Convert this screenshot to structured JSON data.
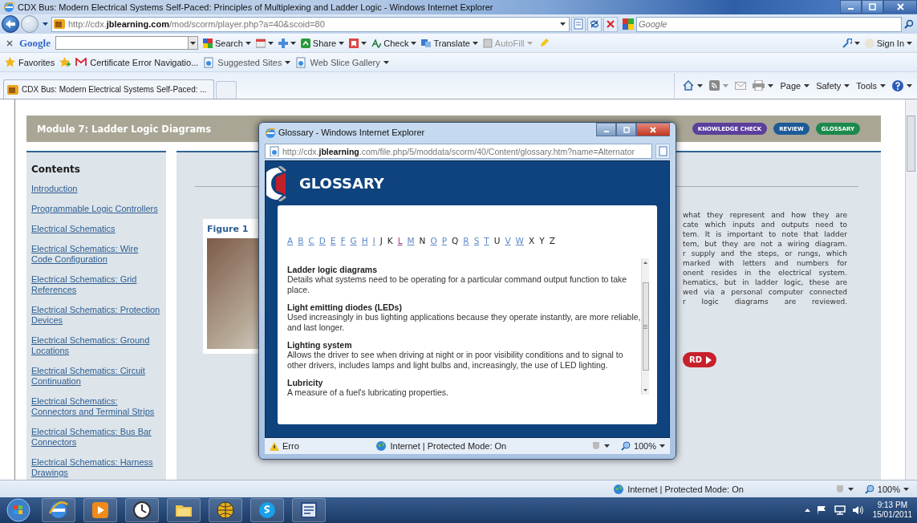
{
  "window": {
    "title": "CDX Bus: Modern Electrical Systems Self-Paced: Principles of Multiplexing and Ladder Logic - Windows Internet Explorer",
    "url": "http://cdx.**jblearning.com**/mod/scorm/player.php?a=40&scoid=80",
    "search_placeholder": "Google"
  },
  "google_toolbar": {
    "logo": "Google",
    "items": [
      {
        "label": "Search",
        "kind": "search",
        "disabled": false
      },
      {
        "label": "Share",
        "kind": "share",
        "disabled": false
      },
      {
        "label": "Check",
        "kind": "check",
        "disabled": false
      },
      {
        "label": "Translate",
        "kind": "translate",
        "disabled": false
      },
      {
        "label": "AutoFill",
        "kind": "autofill",
        "disabled": true
      }
    ],
    "sign_in": "Sign In"
  },
  "favorites_bar": {
    "label": "Favorites",
    "items": [
      {
        "label": "Certificate Error Navigatio...",
        "kind": "mail",
        "menu": false
      },
      {
        "label": "Suggested Sites",
        "kind": "page",
        "menu": true
      },
      {
        "label": "Web Slice Gallery",
        "kind": "page",
        "menu": true
      }
    ]
  },
  "tabs": [
    {
      "label": "CDX Bus: Modern Electrical Systems Self-Paced: ...",
      "selected": true
    }
  ],
  "command_bar": [
    "Page",
    "Safety",
    "Tools"
  ],
  "page": {
    "module_title": "Module 7: Ladder Logic Diagrams",
    "nav_buttons": [
      {
        "label": "KNOWLEDGE CHECK",
        "color": "#5b3f9c"
      },
      {
        "label": "REVIEW",
        "color": "#1d5b98"
      },
      {
        "label": "GLOSSARY",
        "color": "#1b8a4c"
      }
    ],
    "contents": {
      "heading": "Contents",
      "items": [
        "Introduction",
        "Programmable Logic Controllers",
        "Electrical Schematics",
        "Electrical Schematics: Wire Code Configuration",
        "Electrical Schematics: Grid References",
        "Electrical Schematics: Protection Devices",
        "Electrical Schematics: Ground Locations",
        "Electrical Schematics: Circuit Continuation",
        "Electrical Schematics: Connectors and Terminal Strips",
        "Electrical Schematics: Bus Bar Connectors",
        "Electrical Schematics: Harness Drawings"
      ]
    },
    "figure": {
      "caption": "Figure 1"
    },
    "paragraph_lines": [
      "what they represent and how they are",
      "cate which inputs and outputs need to",
      "tem. It is important to note that ladder",
      "tem, but they are not a wiring diagram.",
      "r supply and the steps, or rungs, which",
      "marked with letters and numbers for",
      "onent resides in the electrical system.",
      "hematics, but in ladder logic, these are",
      "wed via a personal computer connected",
      "r logic diagrams are reviewed."
    ],
    "forward_button": "RD"
  },
  "popup": {
    "title": "Glossary - Windows Internet Explorer",
    "url": "http://cdx.**jblearning**.com/file.php/5/moddata/scorm/40/Content/glossary.htm?name=Alternator",
    "heading": "GLOSSARY",
    "letters": [
      {
        "letter": "A",
        "kind": "link"
      },
      {
        "letter": "B",
        "kind": "link"
      },
      {
        "letter": "C",
        "kind": "link"
      },
      {
        "letter": "D",
        "kind": "link"
      },
      {
        "letter": "E",
        "kind": "link"
      },
      {
        "letter": "F",
        "kind": "link"
      },
      {
        "letter": "G",
        "kind": "link"
      },
      {
        "letter": "H",
        "kind": "link"
      },
      {
        "letter": "I",
        "kind": "link"
      },
      {
        "letter": "J",
        "kind": "text"
      },
      {
        "letter": "K",
        "kind": "text"
      },
      {
        "letter": "L",
        "kind": "visited"
      },
      {
        "letter": "M",
        "kind": "link"
      },
      {
        "letter": "N",
        "kind": "text"
      },
      {
        "letter": "O",
        "kind": "link"
      },
      {
        "letter": "P",
        "kind": "link"
      },
      {
        "letter": "Q",
        "kind": "text"
      },
      {
        "letter": "R",
        "kind": "link"
      },
      {
        "letter": "S",
        "kind": "link"
      },
      {
        "letter": "T",
        "kind": "link"
      },
      {
        "letter": "U",
        "kind": "text"
      },
      {
        "letter": "V",
        "kind": "link"
      },
      {
        "letter": "W",
        "kind": "link"
      },
      {
        "letter": "X",
        "kind": "text"
      },
      {
        "letter": "Y",
        "kind": "text"
      },
      {
        "letter": "Z",
        "kind": "text"
      }
    ],
    "entries": [
      {
        "term": "Ladder logic diagrams",
        "definition": "Details what systems need to be operating for a particular command output function to take place."
      },
      {
        "term": "Light emitting diodes (LEDs)",
        "definition": "Used increasingly in bus lighting applications because they operate instantly, are more reliable, and last longer."
      },
      {
        "term": "Lighting system",
        "definition": "Allows the driver to see when driving at night or in poor visibility conditions and to signal to other drivers, includes lamps and light bulbs and, increasingly, the use of LED lighting."
      },
      {
        "term": "Lubricity",
        "definition": "A measure of a fuel's lubricating properties."
      }
    ],
    "status": {
      "error": "Erro",
      "zone": "Internet | Protected Mode: On",
      "zoom": "100%"
    }
  },
  "status_bar": {
    "zone": "Internet | Protected Mode: On",
    "zoom": "100%"
  },
  "taskbar": {
    "time": "9:13 PM",
    "date": "15/01/2011"
  }
}
